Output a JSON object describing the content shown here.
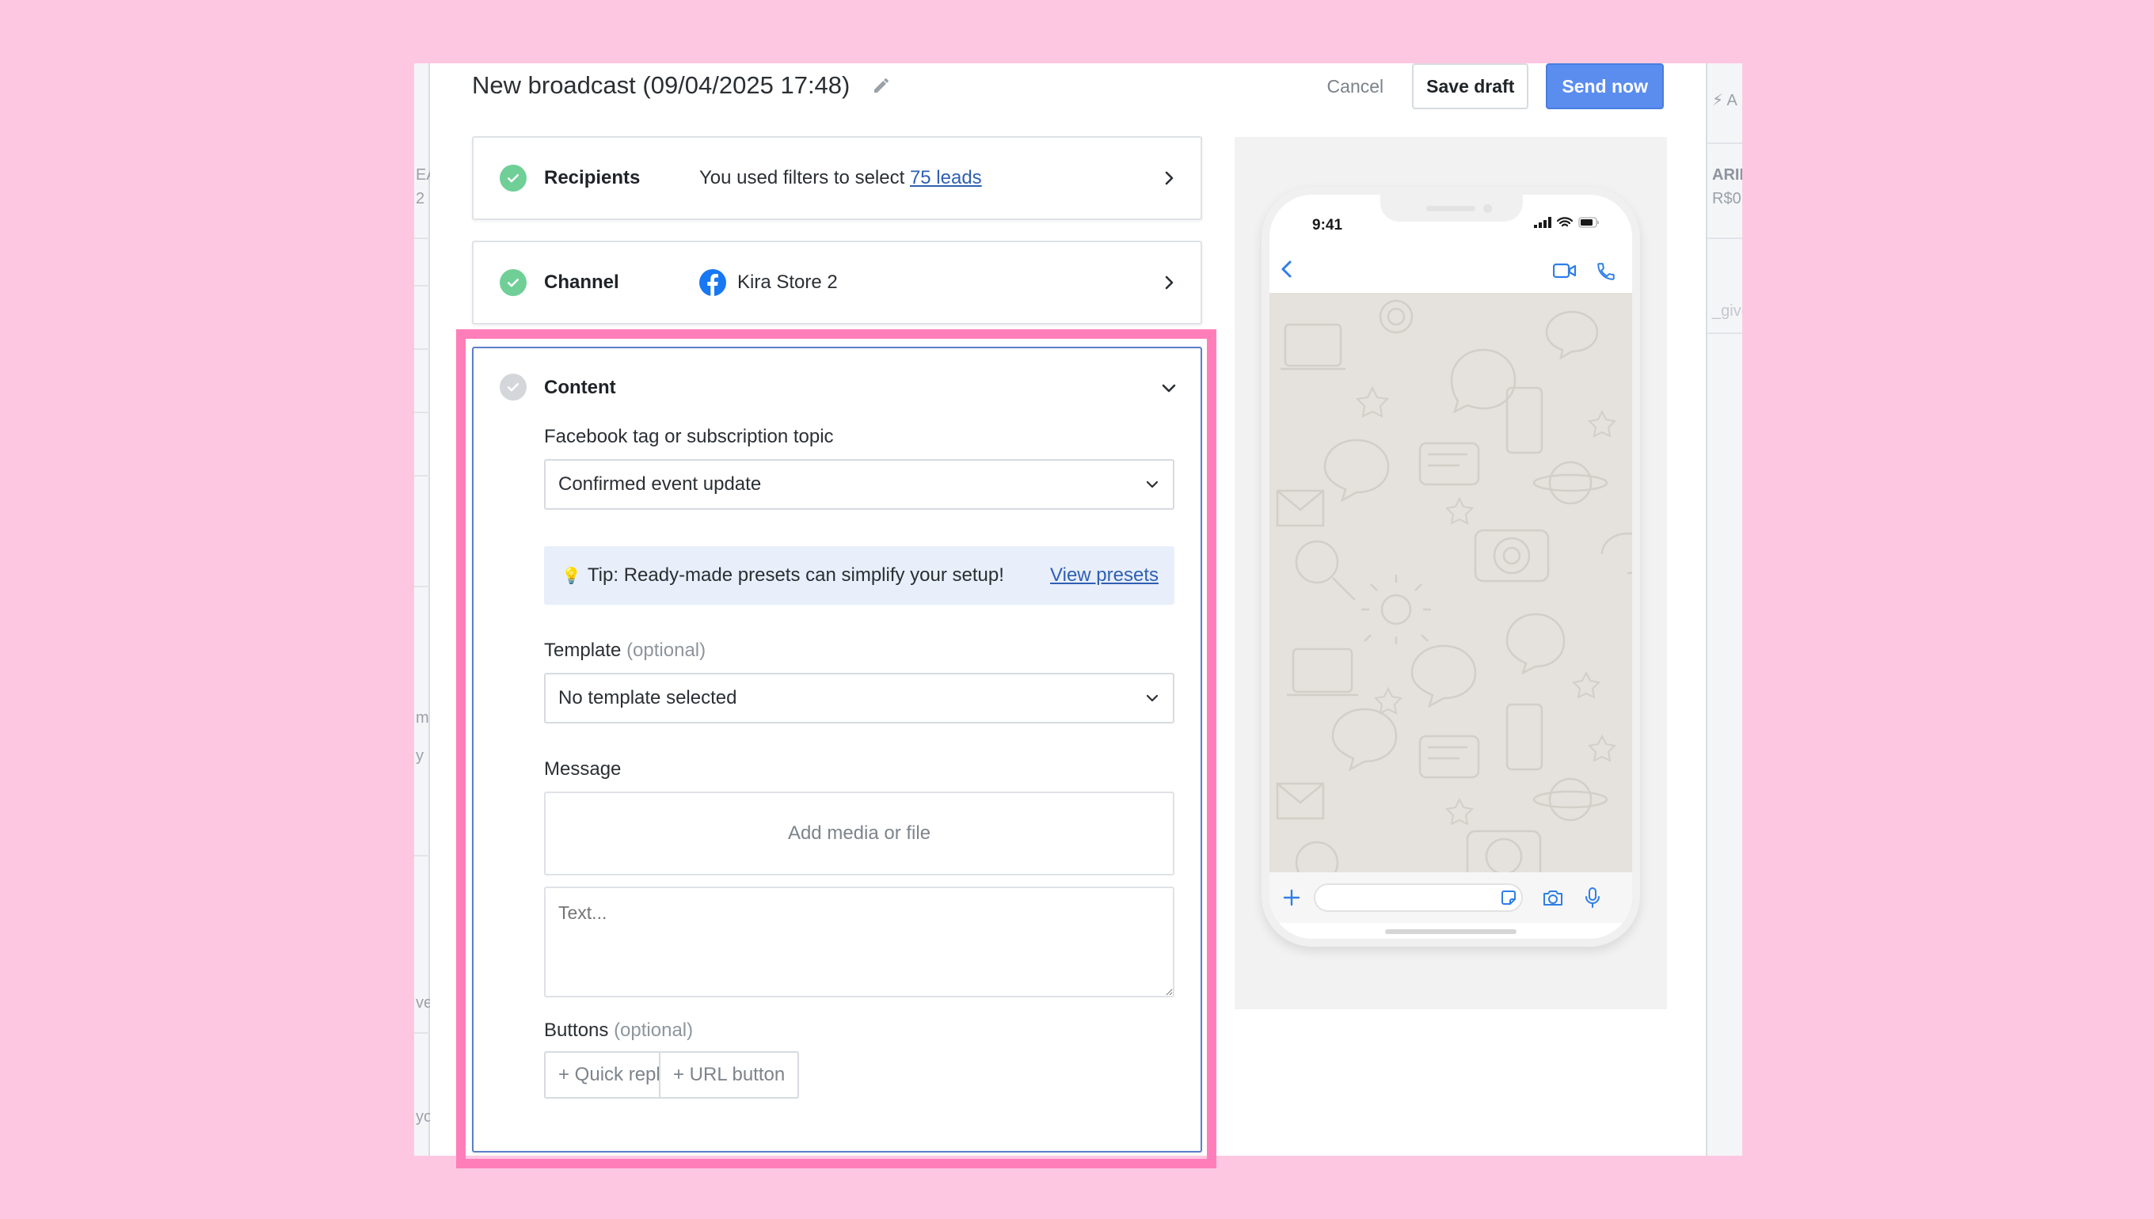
{
  "modal": {
    "title": "New broadcast (09/04/2025 17:48)",
    "cancel_label": "Cancel",
    "save_draft_label": "Save draft",
    "send_now_label": "Send now"
  },
  "recipients": {
    "label": "Recipients",
    "text_prefix": "You used filters to select ",
    "link_text": "75 leads"
  },
  "channel": {
    "label": "Channel",
    "value": "Kira Store 2"
  },
  "content": {
    "label": "Content",
    "tag_label": "Facebook tag or subscription topic",
    "tag_value": "Confirmed event update",
    "tip_text": "Tip: Ready-made presets can simplify your setup!",
    "tip_link": "View presets",
    "template_label": "Template",
    "template_optional": "(optional)",
    "template_value": "No template selected",
    "message_label": "Message",
    "media_label": "Add media or file",
    "text_placeholder": "Text...",
    "buttons_label": "Buttons",
    "buttons_optional": "(optional)",
    "quick_reply_label": "+ Quick reply",
    "url_button_label": "+ URL button"
  },
  "preview": {
    "time": "9:41"
  },
  "background": {
    "left_fragments": [
      "EA",
      "2",
      "m",
      "y",
      "ve",
      "yo"
    ],
    "right_fragments": [
      "A",
      "ARIN",
      "R$0",
      "_givea"
    ]
  },
  "colors": {
    "page_background": "#fec7e1",
    "highlight": "#ff7eb9",
    "primary": "#5b8def",
    "success": "#6fcf97",
    "link": "#2f5fb3",
    "tip_background": "#e8effb"
  }
}
